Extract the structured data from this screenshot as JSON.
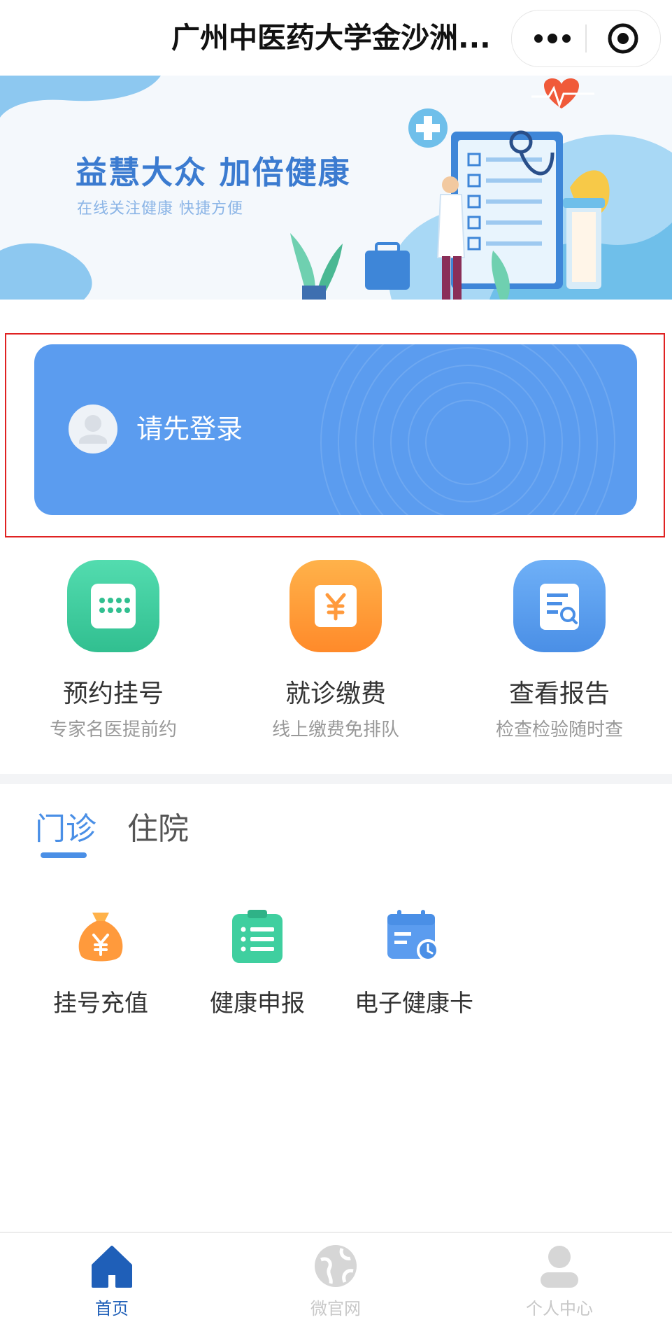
{
  "navbar": {
    "title": "广州中医药大学金沙洲...",
    "more_icon": "more-dots-icon",
    "close_icon": "target-circle-icon"
  },
  "banner": {
    "title": "益慧大众  加倍健康",
    "subtitle": "在线关注健康 快捷方便"
  },
  "login_card": {
    "text": "请先登录",
    "color": "#5b9cef"
  },
  "services": [
    {
      "title": "预约挂号",
      "subtitle": "专家名医提前约",
      "icon": "calendar-grid-icon",
      "color": "#3fcf9f"
    },
    {
      "title": "就诊缴费",
      "subtitle": "线上缴费免排队",
      "icon": "yen-icon",
      "color": "#ff9a3c"
    },
    {
      "title": "查看报告",
      "subtitle": "检查检验随时查",
      "icon": "report-search-icon",
      "color": "#5b9cef"
    }
  ],
  "tabs": [
    {
      "label": "门诊",
      "active": true
    },
    {
      "label": "住院",
      "active": false
    }
  ],
  "outpatient_items": [
    {
      "label": "挂号充值",
      "icon": "money-bag-icon"
    },
    {
      "label": "健康申报",
      "icon": "clipboard-list-icon"
    },
    {
      "label": "电子健康卡",
      "icon": "calendar-clock-icon"
    }
  ],
  "tabbar": [
    {
      "label": "首页",
      "icon": "home-icon",
      "active": true
    },
    {
      "label": "微官网",
      "icon": "globe-icon",
      "active": false
    },
    {
      "label": "个人中心",
      "icon": "user-icon",
      "active": false
    }
  ],
  "colors": {
    "accent": "#4a8fe6",
    "highlight_border": "#e02222"
  }
}
